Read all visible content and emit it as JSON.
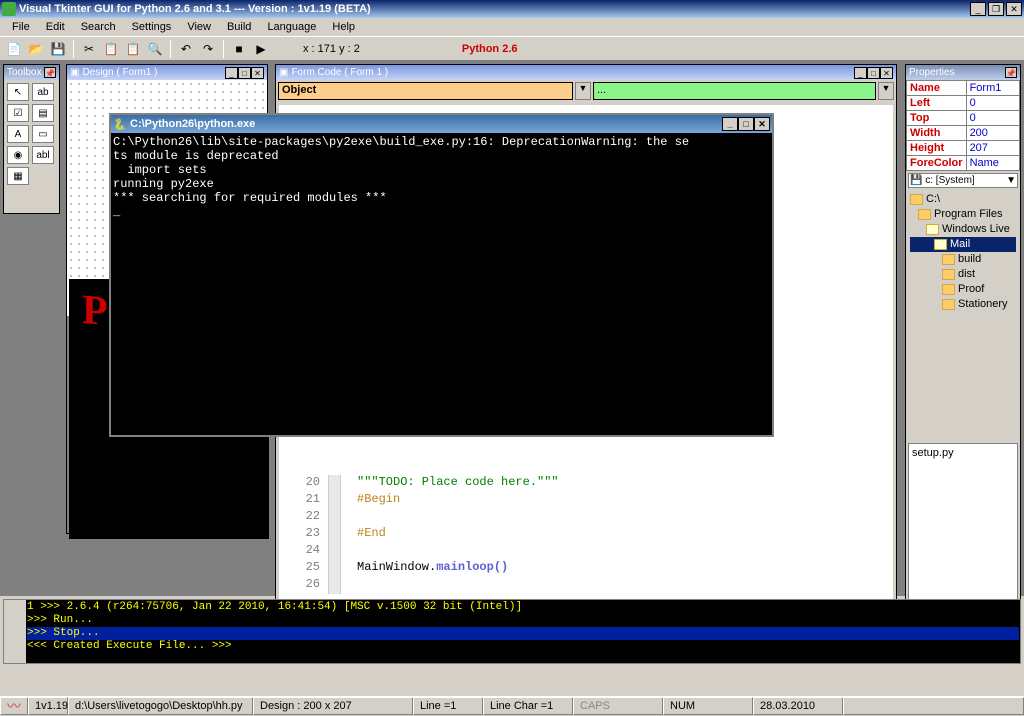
{
  "title": "Visual Tkinter GUI for Python 2.6 and 3.1 --- Version : 1v1.19 (BETA)",
  "menu": [
    "File",
    "Edit",
    "Search",
    "Settings",
    "View",
    "Build",
    "Language",
    "Help"
  ],
  "toolbar": {
    "coords": "x : 171  y : 2",
    "python_label": "Python 2.6"
  },
  "toolbox": {
    "title": "Toolbox"
  },
  "design": {
    "title": "Design ( Form1 )"
  },
  "formcode": {
    "title": "Form Code ( Form 1 )",
    "object_label": "Object",
    "object2": "..."
  },
  "code": {
    "lines": [
      {
        "n": "20",
        "text": "\"\"\"TODO: Place code here.\"\"\"",
        "cls": "ct-str"
      },
      {
        "n": "21",
        "text": "#Begin",
        "cls": "ct-comment"
      },
      {
        "n": "22",
        "text": "",
        "cls": ""
      },
      {
        "n": "23",
        "text": "#End",
        "cls": "ct-comment"
      },
      {
        "n": "24",
        "text": "",
        "cls": ""
      },
      {
        "n": "25",
        "text": "MainWindow.",
        "rest": "mainloop()",
        "cls": "ct-func"
      },
      {
        "n": "26",
        "text": "",
        "cls": ""
      }
    ]
  },
  "console": {
    "title": "C:\\Python26\\python.exe",
    "body": "C:\\Python26\\lib\\site-packages\\py2exe\\build_exe.py:16: DeprecationWarning: the se\nts module is deprecated\n  import sets\nrunning py2exe\n*** searching for required modules ***\n_"
  },
  "properties": {
    "title": "Properties",
    "rows": [
      {
        "name": "Name",
        "val": "Form1"
      },
      {
        "name": "Left",
        "val": "0"
      },
      {
        "name": "Top",
        "val": "0"
      },
      {
        "name": "Width",
        "val": "200"
      },
      {
        "name": "Height",
        "val": "207"
      },
      {
        "name": "ForeColor",
        "val": "Name"
      }
    ],
    "drive": "c: [System]",
    "tree": [
      {
        "label": "C:\\",
        "indent": 0,
        "open": false,
        "sel": false
      },
      {
        "label": "Program Files",
        "indent": 1,
        "open": false,
        "sel": false
      },
      {
        "label": "Windows Live",
        "indent": 2,
        "open": true,
        "sel": false
      },
      {
        "label": "Mail",
        "indent": 3,
        "open": true,
        "sel": true
      },
      {
        "label": "build",
        "indent": 4,
        "open": false,
        "sel": false
      },
      {
        "label": "dist",
        "indent": 4,
        "open": false,
        "sel": false
      },
      {
        "label": "Proof",
        "indent": 4,
        "open": false,
        "sel": false
      },
      {
        "label": "Stationery",
        "indent": 4,
        "open": false,
        "sel": false
      }
    ],
    "file": "setup.py"
  },
  "repl": {
    "lines": [
      {
        "t": ">>> 2.6.4 (r264:75706, Jan 22 2010, 16:41:54) [MSC v.1500 32 bit (Intel)]",
        "sel": false,
        "n": "1"
      },
      {
        "t": ">>> Run...",
        "sel": false,
        "n": ""
      },
      {
        "t": ">>> Stop...",
        "sel": true,
        "n": ""
      },
      {
        "t": "<<< Created Execute File... >>>",
        "sel": false,
        "n": ""
      }
    ]
  },
  "status": {
    "version": "1v1.19",
    "path": "d:\\Users\\livetogogo\\Desktop\\hh.py",
    "design": "Design : 200 x 207",
    "line": "Line =1",
    "char": "Line Char =1",
    "caps": "CAPS",
    "num": "NUM",
    "date": "28.03.2010"
  }
}
